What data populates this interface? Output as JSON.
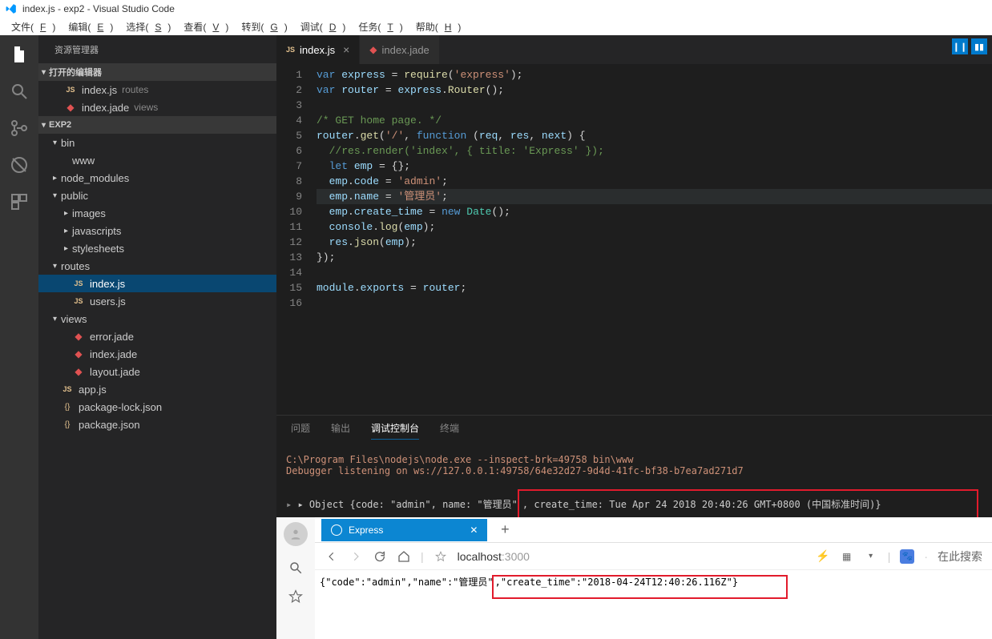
{
  "title": "index.js - exp2 - Visual Studio Code",
  "menubar": [
    "文件(F)",
    "编辑(E)",
    "选择(S)",
    "查看(V)",
    "转到(G)",
    "调试(D)",
    "任务(T)",
    "帮助(H)"
  ],
  "sidebar": {
    "title": "资源管理器",
    "sections": {
      "open_editors": "打开的编辑器",
      "project": "EXP2"
    },
    "open_items": [
      {
        "icon": "js",
        "name": "index.js",
        "suffix": "routes"
      },
      {
        "icon": "jade",
        "name": "index.jade",
        "suffix": "views"
      }
    ],
    "tree": [
      {
        "indent": 1,
        "chev": "▾",
        "name": "bin"
      },
      {
        "indent": 2,
        "chev": "",
        "name": "www",
        "icon": ""
      },
      {
        "indent": 1,
        "chev": "▸",
        "name": "node_modules"
      },
      {
        "indent": 1,
        "chev": "▾",
        "name": "public"
      },
      {
        "indent": 2,
        "chev": "▸",
        "name": "images"
      },
      {
        "indent": 2,
        "chev": "▸",
        "name": "javascripts"
      },
      {
        "indent": 2,
        "chev": "▸",
        "name": "stylesheets"
      },
      {
        "indent": 1,
        "chev": "▾",
        "name": "routes"
      },
      {
        "indent": 2,
        "chev": "",
        "name": "index.js",
        "icon": "js",
        "selected": true
      },
      {
        "indent": 2,
        "chev": "",
        "name": "users.js",
        "icon": "js"
      },
      {
        "indent": 1,
        "chev": "▾",
        "name": "views"
      },
      {
        "indent": 2,
        "chev": "",
        "name": "error.jade",
        "icon": "jade"
      },
      {
        "indent": 2,
        "chev": "",
        "name": "index.jade",
        "icon": "jade"
      },
      {
        "indent": 2,
        "chev": "",
        "name": "layout.jade",
        "icon": "jade"
      },
      {
        "indent": 1,
        "chev": "",
        "name": "app.js",
        "icon": "js"
      },
      {
        "indent": 1,
        "chev": "",
        "name": "package-lock.json",
        "icon": "json"
      },
      {
        "indent": 1,
        "chev": "",
        "name": "package.json",
        "icon": "json"
      }
    ]
  },
  "editor": {
    "tabs": [
      {
        "icon": "js",
        "label": "index.js",
        "active": true,
        "close": true
      },
      {
        "icon": "jade",
        "label": "index.jade",
        "active": false,
        "close": false
      }
    ],
    "lines": [
      {
        "n": 1,
        "html": "<span class='c-kw'>var</span> <span class='c-var'>express</span> = <span class='c-fn'>require</span>(<span class='c-str'>'express'</span>);"
      },
      {
        "n": 2,
        "html": "<span class='c-kw'>var</span> <span class='c-var'>router</span> = <span class='c-var'>express</span>.<span class='c-fn'>Router</span>();"
      },
      {
        "n": 3,
        "html": ""
      },
      {
        "n": 4,
        "html": "<span class='c-cmt'>/* GET home page. */</span>"
      },
      {
        "n": 5,
        "html": "<span class='c-var'>router</span>.<span class='c-fn'>get</span>(<span class='c-str'>'/'</span>, <span class='c-kw'>function</span> (<span class='c-var'>req</span>, <span class='c-var'>res</span>, <span class='c-var'>next</span>) {"
      },
      {
        "n": 6,
        "html": "  <span class='c-cmt'>//res.render('index', { title: 'Express' });</span>"
      },
      {
        "n": 7,
        "html": "  <span class='c-kw'>let</span> <span class='c-var'>emp</span> = {};"
      },
      {
        "n": 8,
        "html": "  <span class='c-var'>emp</span>.<span class='c-var'>code</span> = <span class='c-str'>'admin'</span>;"
      },
      {
        "n": 9,
        "hl": true,
        "html": "  <span class='c-var'>emp</span>.<span class='c-var'>name</span> = <span class='c-str'>'管理员'</span>;"
      },
      {
        "n": 10,
        "html": "  <span class='c-var'>emp</span>.<span class='c-var'>create_time</span> = <span class='c-kw'>new</span> <span class='c-cls'>Date</span>();"
      },
      {
        "n": 11,
        "html": "  <span class='c-var'>console</span>.<span class='c-fn'>log</span>(<span class='c-var'>emp</span>);"
      },
      {
        "n": 12,
        "html": "  <span class='c-var'>res</span>.<span class='c-fn'>json</span>(<span class='c-var'>emp</span>);"
      },
      {
        "n": 13,
        "html": "});"
      },
      {
        "n": 14,
        "html": ""
      },
      {
        "n": 15,
        "html": "<span class='c-var'>module</span>.<span class='c-var'>exports</span> = <span class='c-var'>router</span>;"
      },
      {
        "n": 16,
        "html": ""
      }
    ]
  },
  "panel": {
    "tabs": [
      "问题",
      "输出",
      "调试控制台",
      "终端"
    ],
    "active_tab": 2,
    "line1": "C:\\Program Files\\nodejs\\node.exe --inspect-brk=49758 bin\\www",
    "line2": "Debugger listening on ws://127.0.0.1:49758/64e32d27-9d4d-41fc-bf38-b7ea7ad271d7",
    "obj_prefix": "▸ Object {code: \"admin\", name: \"管理员\"",
    "obj_boxed": ", create_time: Tue Apr 24 2018 20:40:26 GMT+0800 (中国标准时间)}"
  },
  "browser": {
    "tab_label": "Express",
    "address_prefix": "localhost",
    "address_suffix": ":3000",
    "search_label": "在此搜索",
    "json_prefix": "{\"code\":\"admin\",\"name\":\"管理员\"",
    "json_boxed": ",\"create_time\":\"2018-04-24T12:40:26.116Z\"}"
  }
}
